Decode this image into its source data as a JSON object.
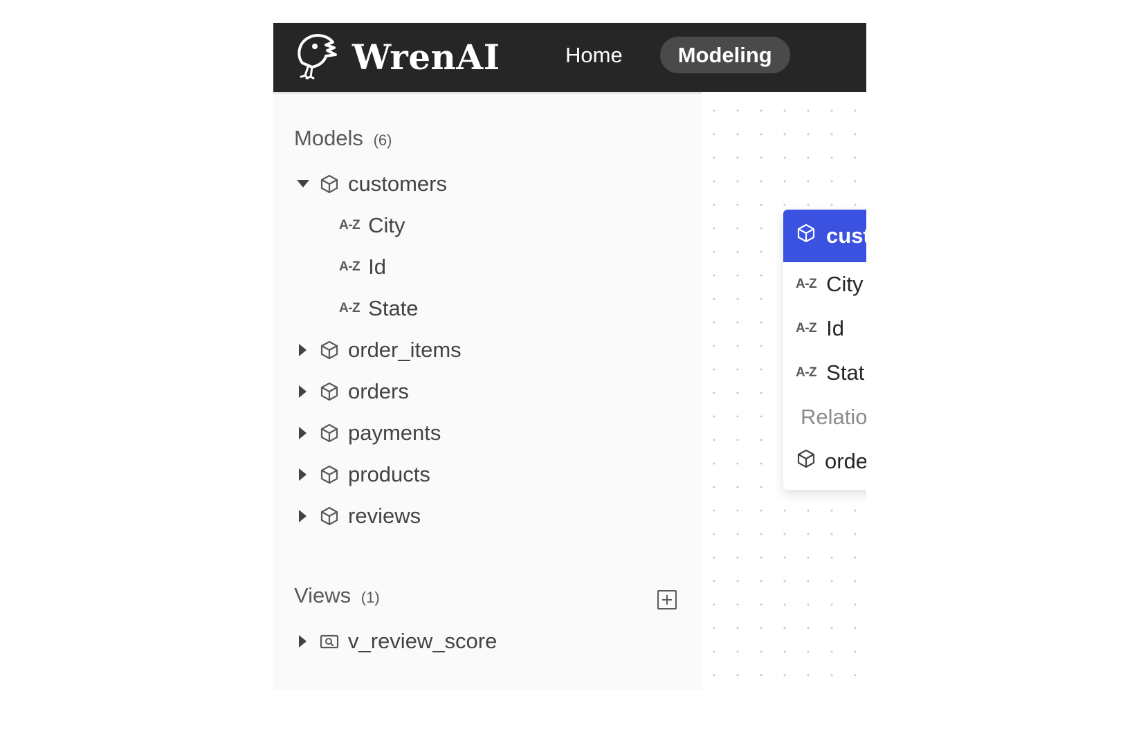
{
  "header": {
    "logo_text": "WrenAI",
    "nav": [
      {
        "label": "Home",
        "active": false
      },
      {
        "label": "Modeling",
        "active": true
      }
    ]
  },
  "sidebar": {
    "models": {
      "title": "Models",
      "count": "(6)",
      "items": [
        {
          "name": "customers",
          "expanded": true,
          "columns": [
            {
              "type_badge": "A-Z",
              "name": "City"
            },
            {
              "type_badge": "A-Z",
              "name": "Id"
            },
            {
              "type_badge": "A-Z",
              "name": "State"
            }
          ]
        },
        {
          "name": "order_items",
          "expanded": false
        },
        {
          "name": "orders",
          "expanded": false
        },
        {
          "name": "payments",
          "expanded": false
        },
        {
          "name": "products",
          "expanded": false
        },
        {
          "name": "reviews",
          "expanded": false
        }
      ]
    },
    "views": {
      "title": "Views",
      "count": "(1)",
      "items": [
        {
          "name": "v_review_score",
          "expanded": false
        }
      ]
    }
  },
  "canvas": {
    "node": {
      "title": "cust",
      "columns": [
        {
          "type_badge": "A-Z",
          "name": "City"
        },
        {
          "type_badge": "A-Z",
          "name": "Id"
        },
        {
          "type_badge": "A-Z",
          "name": "Stat"
        }
      ],
      "relations_label": "Relatio",
      "relations": [
        {
          "name": "orde"
        }
      ]
    },
    "colors": {
      "header": "#262626",
      "node_header": "#3b52e0",
      "sidebar_bg": "#fafafa"
    }
  },
  "icons": {
    "model": "cube-icon",
    "view": "view-icon",
    "column": "az-icon",
    "expanded": "caret-down-icon",
    "collapsed": "caret-right-icon",
    "add": "plus-square-icon"
  }
}
